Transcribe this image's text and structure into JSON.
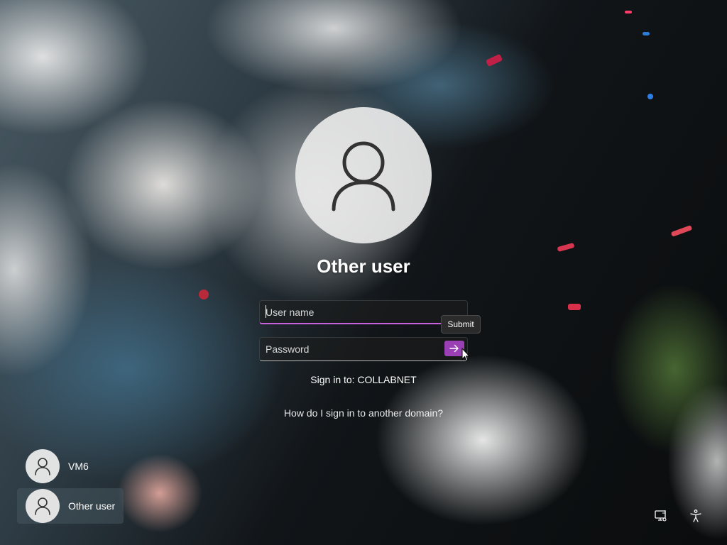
{
  "login": {
    "title": "Other user",
    "username_placeholder": "User name",
    "username_value": "",
    "password_placeholder": "Password",
    "password_value": "",
    "submit_tooltip": "Submit",
    "sign_in_to": "Sign in to: COLLABNET",
    "other_domain_link": "How do I sign in to another domain?",
    "accent_color": "#9b3fb5"
  },
  "users": [
    {
      "name": "VM6",
      "icon": "person-icon",
      "selected": false
    },
    {
      "name": "Other user",
      "icon": "person-icon",
      "selected": true
    }
  ],
  "corner_icons": [
    "network-icon",
    "accessibility-icon"
  ]
}
